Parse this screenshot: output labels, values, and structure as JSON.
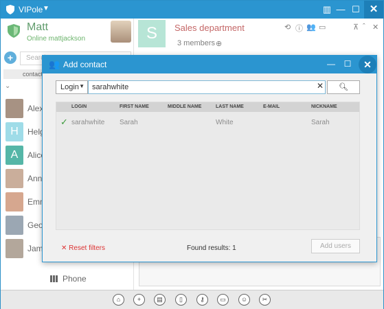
{
  "app": {
    "title": "VIPole"
  },
  "me": {
    "name": "Matt",
    "status": "Online mattjackson"
  },
  "search": {
    "placeholder": "Search"
  },
  "filter": {
    "tab": "contacts"
  },
  "contacts": [
    {
      "name": "Alex",
      "initial": "",
      "color": "#8a6e5a"
    },
    {
      "name": "Helg",
      "initial": "H",
      "color": "#7fd0e0"
    },
    {
      "name": "Alice",
      "initial": "A",
      "color": "#1d9e8a"
    },
    {
      "name": "Anna",
      "initial": "",
      "color": "#b8937a"
    },
    {
      "name": "Emm",
      "initial": "",
      "color": "#c98a6a"
    },
    {
      "name": "Geor",
      "initial": "",
      "color": "#7a8a9a"
    },
    {
      "name": "Jame",
      "initial": "",
      "color": "#9a8a7a"
    }
  ],
  "phone": {
    "label": "Phone"
  },
  "chat": {
    "initial": "S",
    "title": "Sales department",
    "members": "3 members"
  },
  "dialog": {
    "title": "Add contact",
    "search_by": "Login",
    "search_value": "sarahwhite",
    "columns": [
      "LOGIN",
      "FIRST NAME",
      "MIDDLE NAME",
      "LAST NAME",
      "E-MAIL",
      "NICKNAME"
    ],
    "rows": [
      {
        "login": "sarahwhite",
        "first": "Sarah",
        "middle": "",
        "last": "White",
        "email": "",
        "nickname": "Sarah"
      }
    ],
    "reset": "Reset filters",
    "found": "Found results: 1",
    "add": "Add users"
  },
  "colors": {
    "accent": "#2b95d0",
    "brand_green": "#2a7a3a",
    "chat_title": "#b03333",
    "reset": "#d33333"
  }
}
